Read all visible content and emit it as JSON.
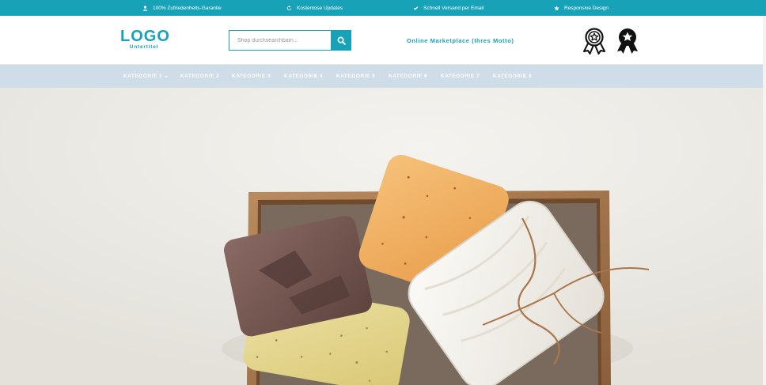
{
  "topbar": {
    "items": [
      {
        "icon": "user-icon",
        "label": "100% Zufriedenheits-Garantie"
      },
      {
        "icon": "refresh-icon",
        "label": "Kostenlose Updates"
      },
      {
        "icon": "check-icon",
        "label": "Schnell Versand per Email"
      },
      {
        "icon": "star-icon",
        "label": "Responsive Design"
      }
    ],
    "color": "#17a2b8"
  },
  "header": {
    "logo_main": "LOGO",
    "logo_sub": "Untertitel",
    "search_placeholder": "Shop durchsearchbarn...",
    "motto": "Online Marketplace (Ihres Motto)",
    "badges": [
      "award-ribbon-outline-icon",
      "award-ribbon-filled-icon"
    ]
  },
  "nav": {
    "categories": [
      {
        "label": "KATEGORIE 1",
        "has_dropdown": true
      },
      {
        "label": "KATEGORIE 2"
      },
      {
        "label": "KATEGORIE 3"
      },
      {
        "label": "KATEGORIE 4"
      },
      {
        "label": "KATEGORIE 5"
      },
      {
        "label": "KATEGORIE 6"
      },
      {
        "label": "KATEGORIE 7"
      },
      {
        "label": "KATEGORIE 8"
      }
    ],
    "background": "#cfdde8"
  },
  "hero": {
    "image": "soap-bars-and-towel-in-wooden-tray"
  }
}
